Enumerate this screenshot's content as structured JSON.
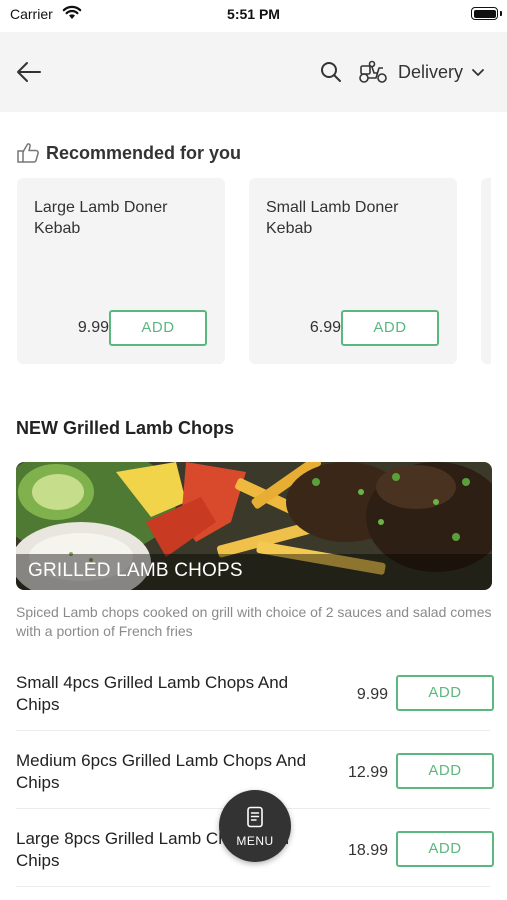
{
  "status_bar": {
    "carrier": "Carrier",
    "time": "5:51 PM",
    "icons": [
      "wifi-icon",
      "battery-icon"
    ]
  },
  "header": {
    "icons": [
      "back-arrow-icon",
      "search-icon",
      "scooter-icon",
      "chevron-down-icon"
    ],
    "delivery_label": "Delivery"
  },
  "recommended": {
    "title": "Recommended for you",
    "icon": "thumbs-up-icon",
    "items": [
      {
        "name": "Large Lamb Doner Kebab",
        "price": "9.99",
        "add_label": "ADD"
      },
      {
        "name": "Small Lamb Doner Kebab",
        "price": "6.99",
        "add_label": "ADD"
      }
    ]
  },
  "category": {
    "title": "NEW Grilled Lamb Chops",
    "banner_caption": "GRILLED LAMB CHOPS",
    "description": "Spiced Lamb chops cooked on grill with choice of 2 sauces and salad comes with a portion of French fries",
    "items": [
      {
        "name": "Small 4pcs Grilled Lamb Chops And Chips",
        "price": "9.99",
        "add_label": "ADD"
      },
      {
        "name": "Medium 6pcs Grilled Lamb Chops And Chips",
        "price": "12.99",
        "add_label": "ADD"
      },
      {
        "name": "Large 8pcs Grilled Lamb Chops And Chips",
        "price": "18.99",
        "add_label": "ADD"
      }
    ]
  },
  "menu_fab": {
    "label": "MENU",
    "icon": "menu-book-icon"
  },
  "colors": {
    "accent": "#5cb77f",
    "header_bg": "#f4f4f4",
    "card_bg": "#f4f4f4",
    "fab_bg": "#333333"
  }
}
